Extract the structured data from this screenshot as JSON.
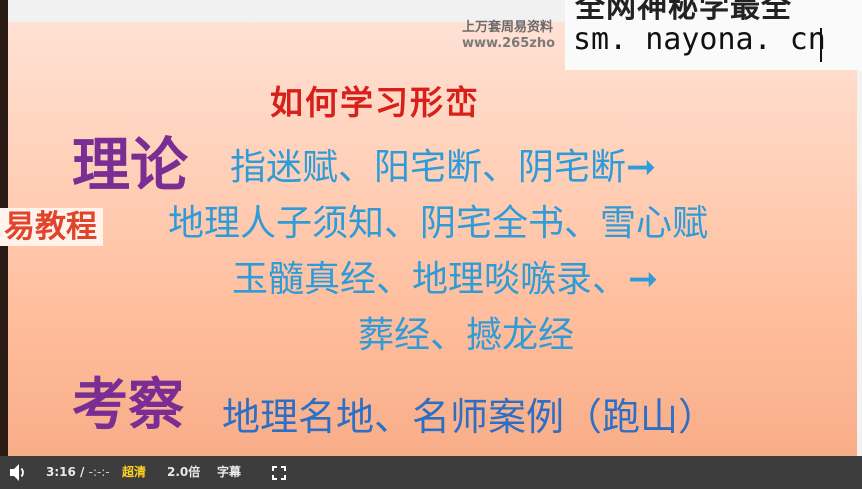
{
  "video": {
    "watermark_line1": "上万套周易资料",
    "watermark_line2": "www.265zho",
    "overlay_top_text": "全网神秘学最全",
    "overlay_url": "sm. nayona. cn",
    "side_brand": "易教程",
    "slide_title": "如何学习形峦",
    "heading_theory": "理论",
    "heading_survey": "考察",
    "theory_line1": "指迷赋、阳宅断、阴宅断➞",
    "theory_line2": "地理人子须知、阴宅全书、雪心赋",
    "theory_line3": "玉髓真经、地理啖嗾录、➞",
    "theory_line4": "葬经、撼龙经",
    "survey_line": "地理名地、名师案例（跑山）"
  },
  "controls": {
    "current_time": "3:16",
    "separator": "/",
    "duration": "-:-:-",
    "quality": "超清",
    "speed": "2.0倍",
    "subtitles": "字幕",
    "volume_icon": "speaker-icon",
    "fullscreen_icon": "fullscreen-icon"
  }
}
